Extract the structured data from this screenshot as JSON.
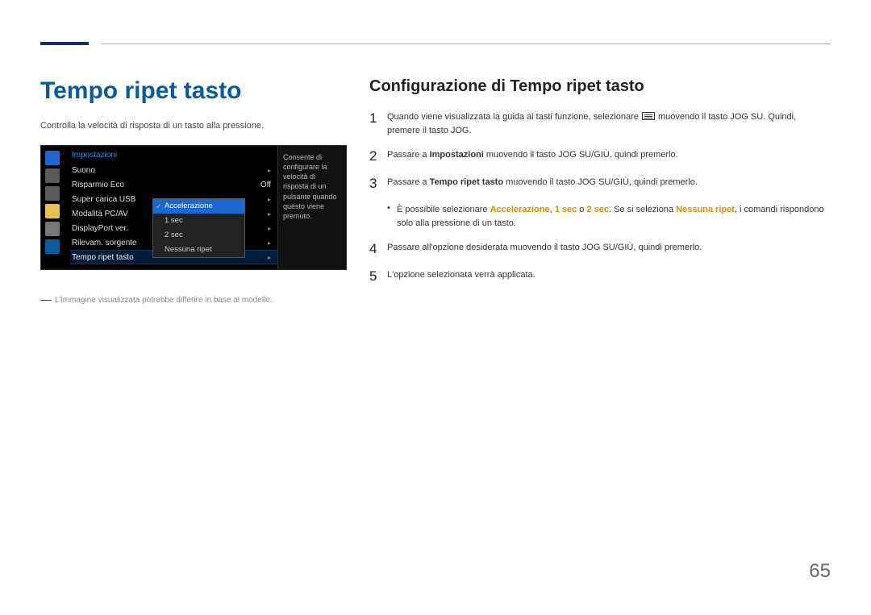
{
  "page_number": "65",
  "left": {
    "heading": "Tempo ripet tasto",
    "intro": "Controlla la velocità di risposta di un tasto alla pressione.",
    "footnote": "L'immagine visualizzata potrebbe differire in base al modello."
  },
  "osd": {
    "title": "Impostazioni",
    "rows": {
      "r0": "Suono",
      "r1": "Risparmio Eco",
      "r1_val": "Off",
      "r2": "Super carica USB",
      "r3": "Modalità PC/AV",
      "r4": "DisplayPort ver.",
      "r5": "Rilevam. sorgente",
      "r6": "Tempo ripet tasto"
    },
    "popup": {
      "o0": "Accelerazione",
      "o1": "1 sec",
      "o2": "2 sec",
      "o3": "Nessuna ripet"
    },
    "desc": "Consente di configurare la velocità di risposta di un pulsante quando questo viene premuto."
  },
  "right": {
    "heading": "Configurazione di Tempo ripet tasto",
    "step1_a": "Quando viene visualizzata la guida ai tasti funzione, selezionare ",
    "step1_b": " muovendo il tasto JOG SU. Quindi, premere il tasto JOG.",
    "step2_a": "Passare a ",
    "step2_b": "Impostazioni",
    "step2_c": " muovendo il tasto JOG SU/GIÙ, quindi premerlo.",
    "step3_a": "Passare a ",
    "step3_b": "Tempo ripet tasto",
    "step3_c": " muovendo il tasto JOG SU/GIÙ, quindi premerlo.",
    "bullet_a": "È possibile selezionare ",
    "bullet_b": "Accelerazione",
    "bullet_c": ", ",
    "bullet_d": "1 sec",
    "bullet_e": " o ",
    "bullet_f": "2 sec",
    "bullet_g": ". Se si seleziona ",
    "bullet_h": "Nessuna ripet",
    "bullet_i": ", i comandi rispondono solo alla pressione di un tasto.",
    "step4": "Passare all'opzione desiderata muovendo il tasto JOG SU/GIÙ, quindi premerlo.",
    "step5": "L'opzione selezionata verrà applicata."
  }
}
